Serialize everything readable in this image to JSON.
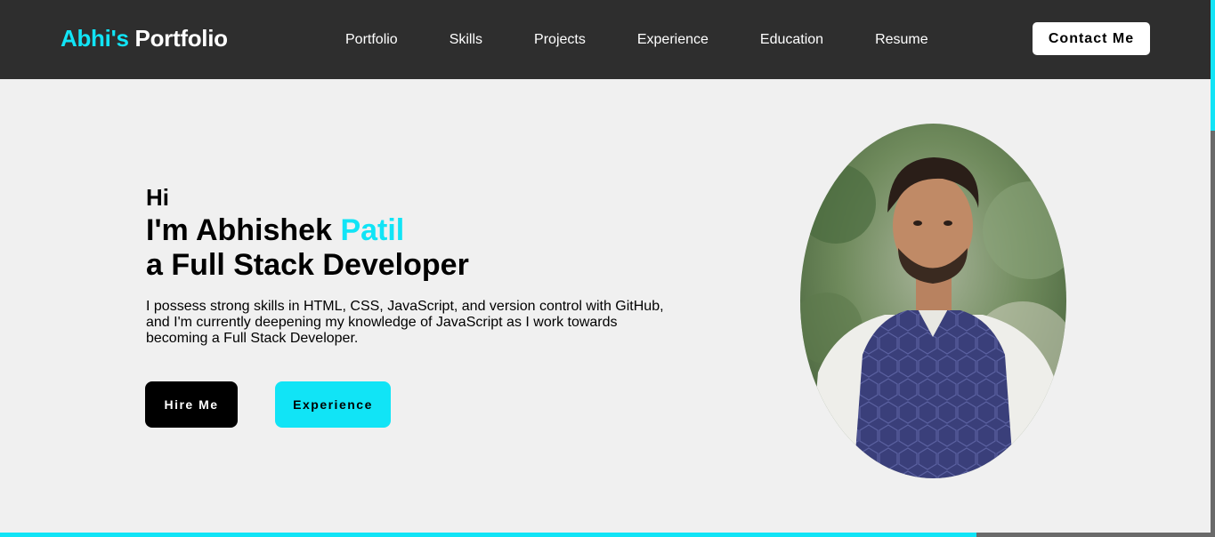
{
  "nav": {
    "brand_first": "Abhi's",
    "brand_second": "Portfolio",
    "links": [
      "Portfolio",
      "Skills",
      "Projects",
      "Experience",
      "Education",
      "Resume"
    ],
    "contact_label": "Contact Me"
  },
  "hero": {
    "greeting": "Hi",
    "name_prefix": "I'm Abhishek",
    "name_highlight": "Patil",
    "role": "a Full Stack Developer",
    "intro": "I possess strong skills in HTML, CSS, JavaScript, and version control with GitHub, and I'm currently deepening my knowledge of JavaScript as I work towards becoming a Full Stack Developer.",
    "hire_label": "Hire Me",
    "experience_label": "Experience"
  },
  "colors": {
    "accent": "#11e4f6",
    "navbar": "#2e2e2e",
    "background": "#f0f0f0"
  },
  "icons": {
    "profile_photo": "profile-photo"
  }
}
